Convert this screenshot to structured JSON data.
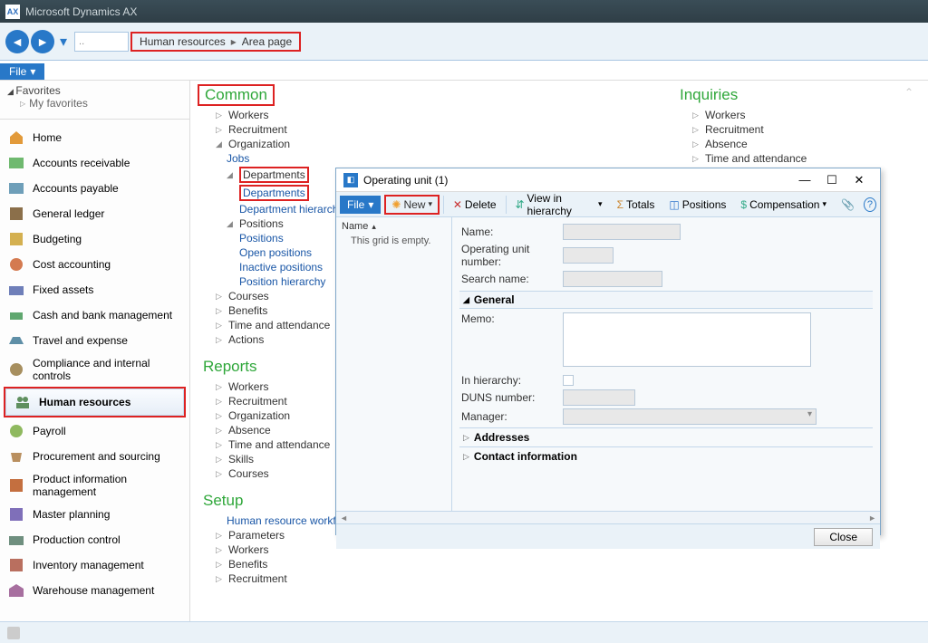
{
  "app": {
    "title": "Microsoft Dynamics AX"
  },
  "breadcrumb": {
    "part1": "Human resources",
    "part2": "Area page",
    "address": ".."
  },
  "file_menu": "File",
  "sidebar": {
    "favorites": "Favorites",
    "my_favorites": "My favorites",
    "modules": [
      "Home",
      "Accounts receivable",
      "Accounts payable",
      "General ledger",
      "Budgeting",
      "Cost accounting",
      "Fixed assets",
      "Cash and bank management",
      "Travel and expense",
      "Compliance and internal controls",
      "Human resources",
      "Payroll",
      "Procurement and sourcing",
      "Product information management",
      "Master planning",
      "Production control",
      "Inventory management",
      "Warehouse management"
    ]
  },
  "common": {
    "header": "Common",
    "workers": "Workers",
    "recruitment": "Recruitment",
    "organization": "Organization",
    "jobs": "Jobs",
    "departments": "Departments",
    "departments_link": "Departments",
    "department_hierarchy": "Department hierarchy",
    "positions": "Positions",
    "positions_link": "Positions",
    "open_positions": "Open positions",
    "inactive_positions": "Inactive positions",
    "position_hierarchy": "Position hierarchy",
    "courses": "Courses",
    "benefits": "Benefits",
    "time_attendance": "Time and attendance",
    "actions": "Actions"
  },
  "reports": {
    "header": "Reports",
    "items": [
      "Workers",
      "Recruitment",
      "Organization",
      "Absence",
      "Time and attendance",
      "Skills",
      "Courses"
    ]
  },
  "setup": {
    "header": "Setup",
    "workflows": "Human resource workflows",
    "items": [
      "Parameters",
      "Workers",
      "Benefits",
      "Recruitment"
    ]
  },
  "inquiries": {
    "header": "Inquiries",
    "items": [
      "Workers",
      "Recruitment",
      "Absence",
      "Time and attendance"
    ]
  },
  "dialog": {
    "title": "Operating unit (1)",
    "file": "File",
    "new": "New",
    "delete": "Delete",
    "view_hierarchy": "View in hierarchy",
    "totals": "Totals",
    "positions": "Positions",
    "compensation": "Compensation",
    "grid_header": "Name",
    "grid_empty": "This grid is empty.",
    "name_lbl": "Name:",
    "opunit_lbl": "Operating unit number:",
    "search_lbl": "Search name:",
    "general": "General",
    "memo_lbl": "Memo:",
    "inhier_lbl": "In hierarchy:",
    "duns_lbl": "DUNS number:",
    "manager_lbl": "Manager:",
    "addresses": "Addresses",
    "contact": "Contact information",
    "close": "Close"
  }
}
